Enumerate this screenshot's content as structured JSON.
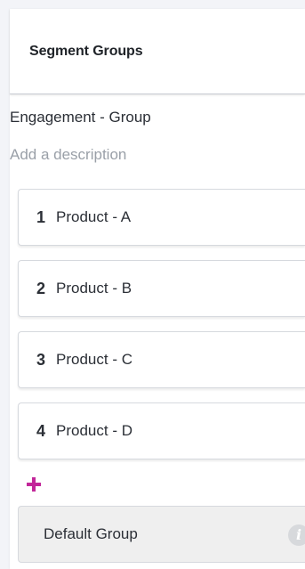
{
  "header": {
    "title": "Segment Groups"
  },
  "group": {
    "name": "Engagement - Group",
    "description_placeholder": "Add a description"
  },
  "segments": [
    {
      "number": "1",
      "label": "Product - A"
    },
    {
      "number": "2",
      "label": "Product - B"
    },
    {
      "number": "3",
      "label": "Product - C"
    },
    {
      "number": "4",
      "label": "Product - D"
    }
  ],
  "add_button": {
    "icon": "plus-icon",
    "color": "#c2279a"
  },
  "default_group": {
    "label": "Default Group",
    "icon": "info-icon"
  }
}
